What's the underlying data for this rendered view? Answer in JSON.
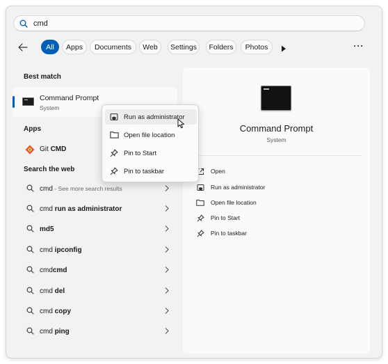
{
  "search": {
    "value": "cmd",
    "placeholder": ""
  },
  "filters": {
    "chips": [
      "All",
      "Apps",
      "Documents",
      "Web",
      "Settings",
      "Folders",
      "Photos"
    ],
    "active": "All"
  },
  "best_match": {
    "heading": "Best match",
    "name": "Command Prompt",
    "type": "System"
  },
  "apps": {
    "heading": "Apps",
    "items": [
      {
        "prefix": "Git ",
        "bold": "CMD"
      }
    ]
  },
  "web": {
    "heading": "Search the web",
    "items": [
      {
        "prefix": "cmd",
        "bold": "",
        "hint": " - See more search results"
      },
      {
        "prefix": "cmd ",
        "bold": "run as administrator",
        "hint": ""
      },
      {
        "prefix": "",
        "bold": "md5",
        "hint": ""
      },
      {
        "prefix": "cmd ",
        "bold": "ipconfig",
        "hint": ""
      },
      {
        "prefix": "cmd",
        "bold": "cmd",
        "hint": ""
      },
      {
        "prefix": "cmd ",
        "bold": "del",
        "hint": ""
      },
      {
        "prefix": "cmd ",
        "bold": "copy",
        "hint": ""
      },
      {
        "prefix": "cmd ",
        "bold": "ping",
        "hint": ""
      }
    ]
  },
  "context_menu": {
    "items": [
      "Run as administrator",
      "Open file location",
      "Pin to Start",
      "Pin to taskbar"
    ]
  },
  "details": {
    "title": "Command Prompt",
    "subtitle": "System",
    "actions": [
      "Open",
      "Run as administrator",
      "Open file location",
      "Pin to Start",
      "Pin to taskbar"
    ]
  },
  "colors": {
    "accent": "#005fb8"
  },
  "icons": {
    "search": "search-icon",
    "back": "arrow-left-icon",
    "play": "play-icon",
    "more": "more-icon",
    "chevron": "chevron-right-icon",
    "shield": "shield-admin-icon",
    "folder": "folder-icon",
    "pin": "pin-icon",
    "open": "open-external-icon",
    "git": "git-icon"
  }
}
